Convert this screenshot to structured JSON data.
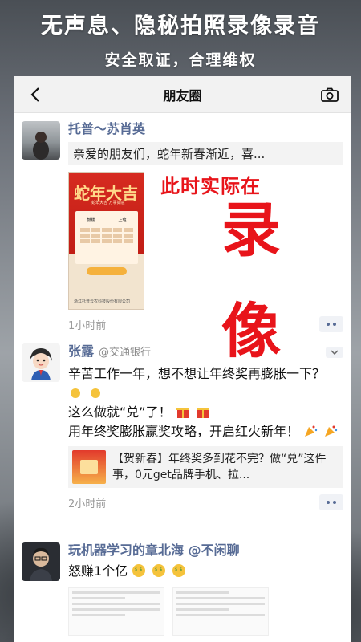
{
  "banner": {
    "headline": "无声息、隐秘拍照录像录音",
    "subline": "安全取证，合理维权"
  },
  "navbar": {
    "title": "朋友圈",
    "back_icon": "back-arrow-icon",
    "camera_icon": "camera-icon"
  },
  "overlay": {
    "line1": "此时实际在",
    "line2": "录",
    "line3": "像"
  },
  "posts": [
    {
      "author": "托普～苏肖英",
      "text": "亲爱的朋友们，蛇年新春渐近，喜...",
      "poster": {
        "title": "蛇年大吉",
        "sub": "蛇年大吉 万事如意",
        "row_left": "鼓楼",
        "row_right": "上班",
        "footer": "浙江托普云农科技股份有限公司"
      },
      "time": "1小时前"
    },
    {
      "author": "张露",
      "org": "@交通银行",
      "lines": [
        "辛苦工作一年，想不想让年终奖再膨胀一下？",
        "这么做就“兑”了！",
        "用年终奖膨胀赢奖攻略，开启红火新年！"
      ],
      "share": "【贺新春】年终奖多到花不完？做“兑”这件事，0元get品牌手机、拉...",
      "time": "2小时前"
    },
    {
      "author": "玩机器学习的章北海 @不闲聊",
      "text": "怒赚1个亿"
    }
  ],
  "colors": {
    "link": "#576b95",
    "overlay_red": "#e8141a"
  }
}
